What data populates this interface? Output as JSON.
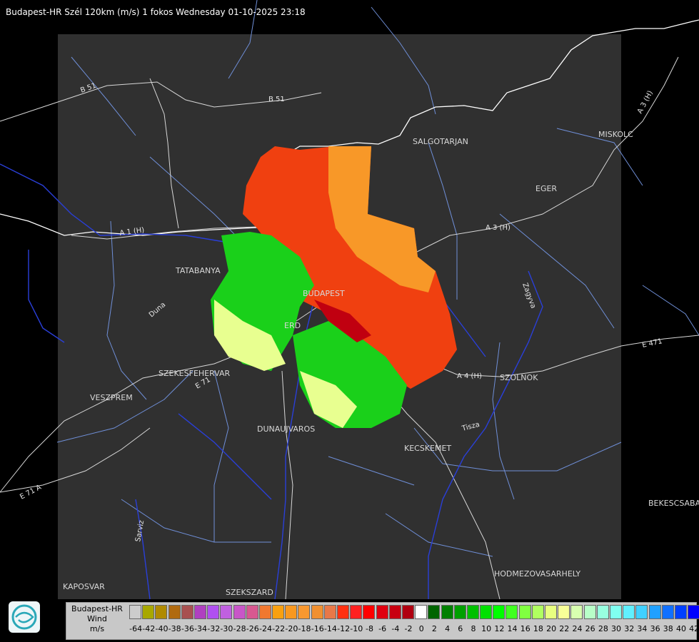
{
  "header": {
    "title": "Budapest-HR Szél 120km (m/s) 1 fokos Wednesday 01-10-2025 23:18"
  },
  "map": {
    "cities": [
      "SALGOTARJAN",
      "MISKOLC",
      "EGER",
      "TATABANYA",
      "BUDAPEST",
      "ERD",
      "SZEKESFEHERVAR",
      "VESZPREM",
      "SZOLNOK",
      "DUNAUJVAROS",
      "KECSKEMET",
      "BEKESCSABA",
      "HODMEZOVASARHELY",
      "KAPOSVAR",
      "SZEKSZARD"
    ],
    "roads": [
      "B 51",
      "B 51",
      "A 1 (H)",
      "A 3 (H)",
      "A 3 (H)",
      "E 71",
      "E 71 A",
      "E 471",
      "A 4 (H)"
    ],
    "rivers": [
      "Duna",
      "Zagyva",
      "Tisza",
      "Sarviz"
    ],
    "colors": {
      "background": "#000000",
      "coverage": "#303030",
      "borders": "#ffffff",
      "rivers": "#2a3fd8",
      "counties": "#6f8fd8"
    }
  },
  "legend": {
    "title_lines": [
      "Budapest-HR",
      "Wind",
      "m/s"
    ],
    "ticks": [
      "-64",
      "-42",
      "-40",
      "-38",
      "-36",
      "-34",
      "-32",
      "-30",
      "-28",
      "-26",
      "-24",
      "-22",
      "-20",
      "-18",
      "-16",
      "-14",
      "-12",
      "-10",
      "-8",
      "-6",
      "-4",
      "-2",
      "0",
      "2",
      "4",
      "6",
      "8",
      "10",
      "12",
      "14",
      "16",
      "18",
      "20",
      "22",
      "24",
      "26",
      "28",
      "30",
      "32",
      "34",
      "36",
      "38",
      "40",
      "42"
    ],
    "colors": [
      "#cccccc",
      "#a8a800",
      "#b08a00",
      "#b06a10",
      "#a85050",
      "#b040c0",
      "#b050f0",
      "#c060e0",
      "#c856c8",
      "#d85890",
      "#f07830",
      "#f8a010",
      "#f89820",
      "#f89830",
      "#f09030",
      "#e87848",
      "#ff3010",
      "#ff2020",
      "#ff0000",
      "#e00010",
      "#c80010",
      "#b00010",
      "#ffffff",
      "#006400",
      "#008000",
      "#00a000",
      "#00c000",
      "#00e000",
      "#00ff00",
      "#40ff20",
      "#80ff40",
      "#b0ff60",
      "#e8ff80",
      "#f8ff98",
      "#d8ffb0",
      "#b8ffc8",
      "#98ffe0",
      "#80fff0",
      "#60f0ff",
      "#40d0ff",
      "#20a0ff",
      "#1070ff",
      "#0040ff",
      "#0000ff"
    ]
  },
  "logo": {
    "name": "HungaroMet logo"
  }
}
